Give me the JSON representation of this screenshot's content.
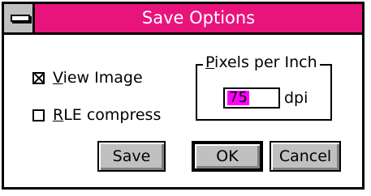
{
  "window": {
    "title": "Save Options",
    "title_color": "#e8147c"
  },
  "options": {
    "view_image": {
      "label": "View Image",
      "checked": true
    },
    "rle_compress": {
      "label": "RLE compress",
      "checked": false
    }
  },
  "resolution": {
    "group_title": "Pixels per Inch",
    "value": "75",
    "unit": "dpi",
    "selection_color": "#ff00ff"
  },
  "buttons": {
    "save": "Save",
    "ok": "OK",
    "cancel": "Cancel"
  },
  "icons": {
    "system_menu": "system-menu-icon",
    "checkbox_checked": "checkbox-checked-icon",
    "checkbox_unchecked": "checkbox-unchecked-icon"
  }
}
